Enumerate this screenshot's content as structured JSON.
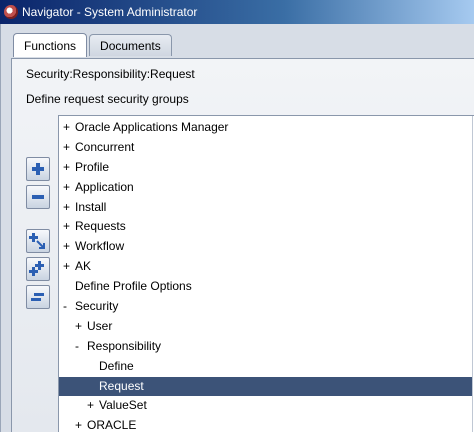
{
  "window": {
    "title": "Navigator - System Administrator"
  },
  "tabs": [
    {
      "label": "Functions",
      "active": true
    },
    {
      "label": "Documents",
      "active": false
    }
  ],
  "function": {
    "path": "Security:Responsibility:Request",
    "description": "Define request security groups"
  },
  "toolbar_icons": [
    "expand-icon",
    "collapse-icon",
    "expand-branch-icon",
    "expand-all-icon",
    "collapse-all-icon"
  ],
  "tree": [
    {
      "prefix": "+",
      "label": "Oracle Applications Manager",
      "depth": 0,
      "selected": false
    },
    {
      "prefix": "+",
      "label": "Concurrent",
      "depth": 0,
      "selected": false
    },
    {
      "prefix": "+",
      "label": "Profile",
      "depth": 0,
      "selected": false
    },
    {
      "prefix": "+",
      "label": "Application",
      "depth": 0,
      "selected": false
    },
    {
      "prefix": "+",
      "label": "Install",
      "depth": 0,
      "selected": false
    },
    {
      "prefix": "+",
      "label": "Requests",
      "depth": 0,
      "selected": false
    },
    {
      "prefix": "+",
      "label": "Workflow",
      "depth": 0,
      "selected": false
    },
    {
      "prefix": "+",
      "label": "AK",
      "depth": 0,
      "selected": false
    },
    {
      "prefix": "",
      "label": "Define Profile Options",
      "depth": 0,
      "selected": false
    },
    {
      "prefix": "-",
      "label": "Security",
      "depth": 0,
      "selected": false
    },
    {
      "prefix": "+",
      "label": "User",
      "depth": 1,
      "selected": false
    },
    {
      "prefix": "-",
      "label": "Responsibility",
      "depth": 1,
      "selected": false
    },
    {
      "prefix": "",
      "label": "Define",
      "depth": 2,
      "selected": false
    },
    {
      "prefix": "",
      "label": "Request",
      "depth": 2,
      "selected": true
    },
    {
      "prefix": "+",
      "label": "ValueSet",
      "depth": 2,
      "selected": false
    },
    {
      "prefix": "+",
      "label": "ORACLE",
      "depth": 1,
      "selected": false
    }
  ],
  "colors": {
    "selection": "#3c5378",
    "titlebar": "#0a246a",
    "background": "#d7dde6"
  }
}
